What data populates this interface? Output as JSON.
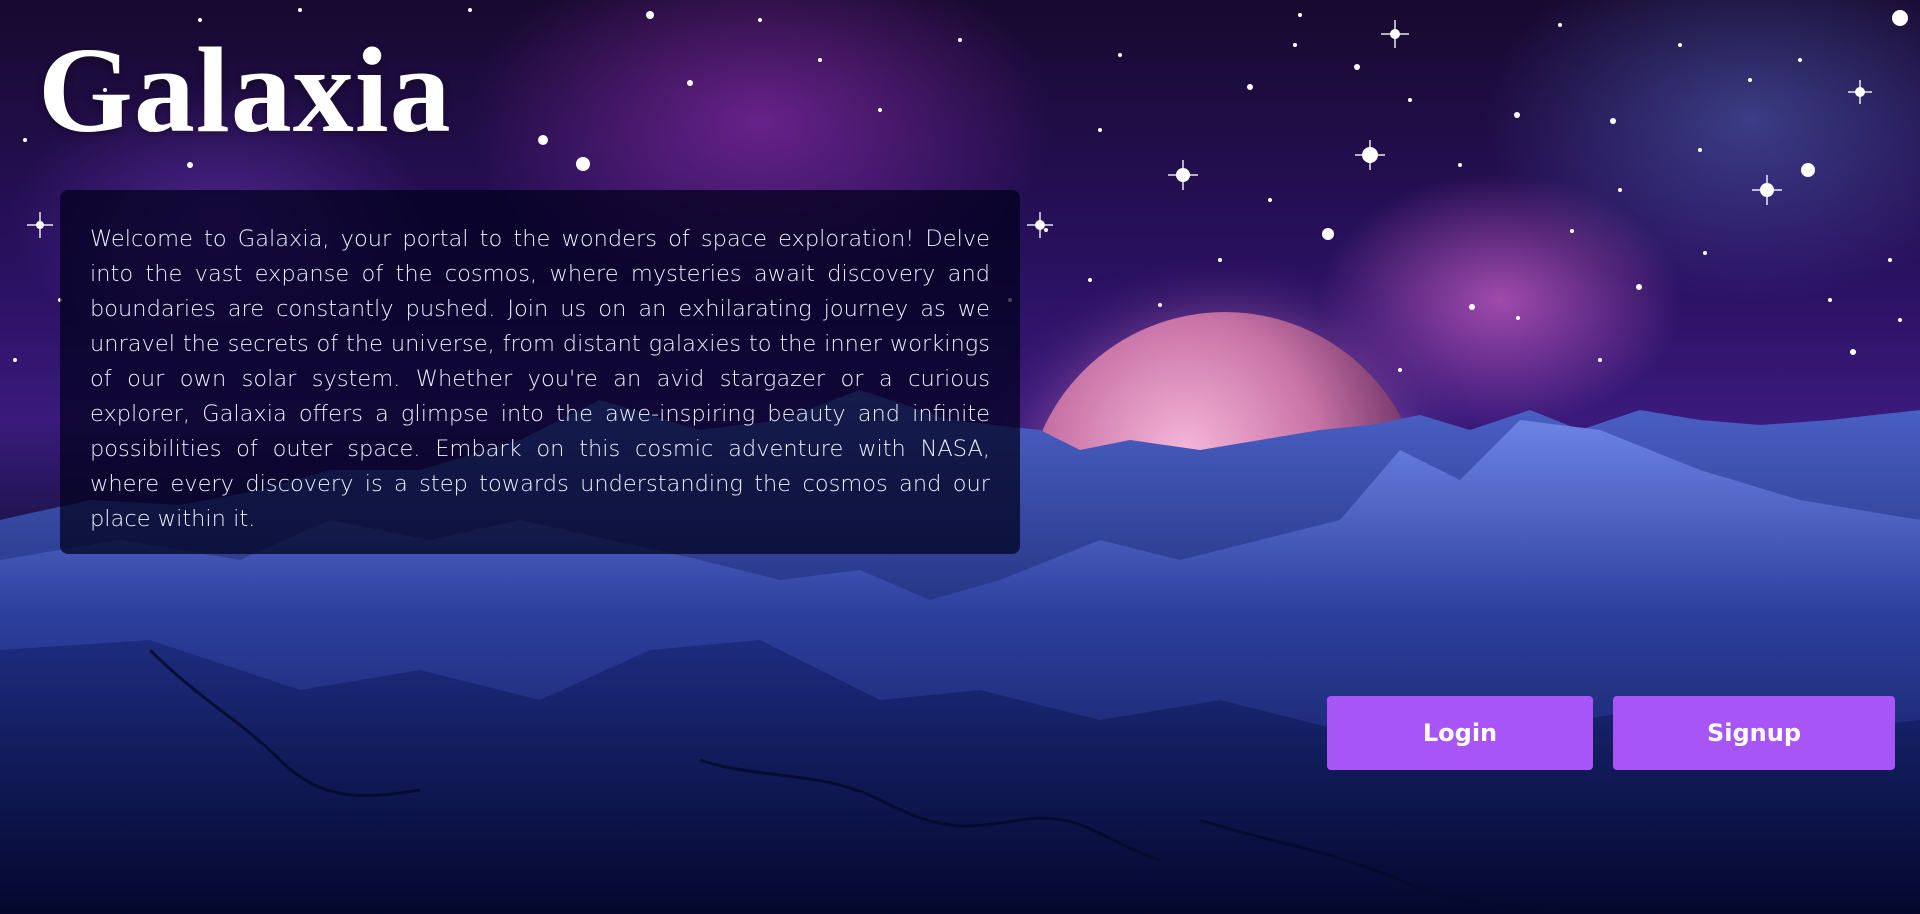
{
  "app": {
    "title": "Galaxia"
  },
  "intro": {
    "text": "Welcome to Galaxia, your portal to the wonders of space exploration! Delve into the vast expanse of the cosmos, where mysteries await discovery and boundaries are constantly pushed. Join us on an exhilarating journey as we unravel the secrets of the universe, from distant galaxies to the inner workings of our own solar system. Whether you're an avid stargazer or a curious explorer, Galaxia offers a glimpse into the awe-inspiring beauty and infinite possibilities of outer space. Embark on this cosmic adventure with NASA, where every discovery is a step towards understanding the cosmos and our place within it."
  },
  "auth": {
    "login_label": "Login",
    "signup_label": "Signup"
  },
  "colors": {
    "button": "#a855f7",
    "overlay": "#00001c",
    "text": "#ffffff"
  }
}
